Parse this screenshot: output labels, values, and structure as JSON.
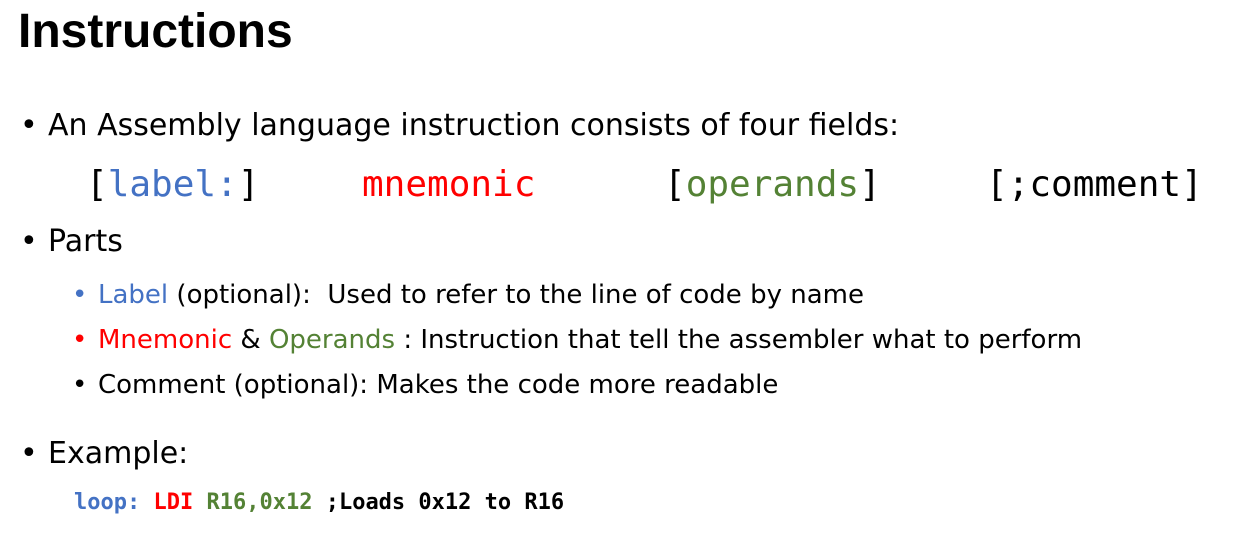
{
  "title": "Instructions",
  "bullet_fields": "An Assembly language instruction consists of four fields:",
  "syntax": {
    "label_open": "[",
    "label": "label:",
    "label_close": "]",
    "mnemonic": "mnemonic",
    "operands_open": "[",
    "operands": "operands",
    "operands_close": "]",
    "comment": "[;comment]"
  },
  "bullet_parts": "Parts",
  "parts": {
    "label_word": "Label",
    "label_rest": " (optional):  Used to refer to the line of code by name",
    "mnemonic_word": "Mnemonic",
    "amp": " & ",
    "operands_word": "Operands",
    "mnemonic_rest": " : Instruction that tell the assembler what to perform",
    "comment_text": "Comment (optional): Makes the code more readable"
  },
  "bullet_example": "Example:",
  "example_code": {
    "label": "loop:",
    "mnemonic": "LDI",
    "operands": "R16,0x12",
    "comment": ";Loads 0x12 to R16"
  },
  "colors": {
    "label_blue": "#4472c4",
    "mnemonic_red": "#ff0000",
    "operands_green": "#548235"
  }
}
